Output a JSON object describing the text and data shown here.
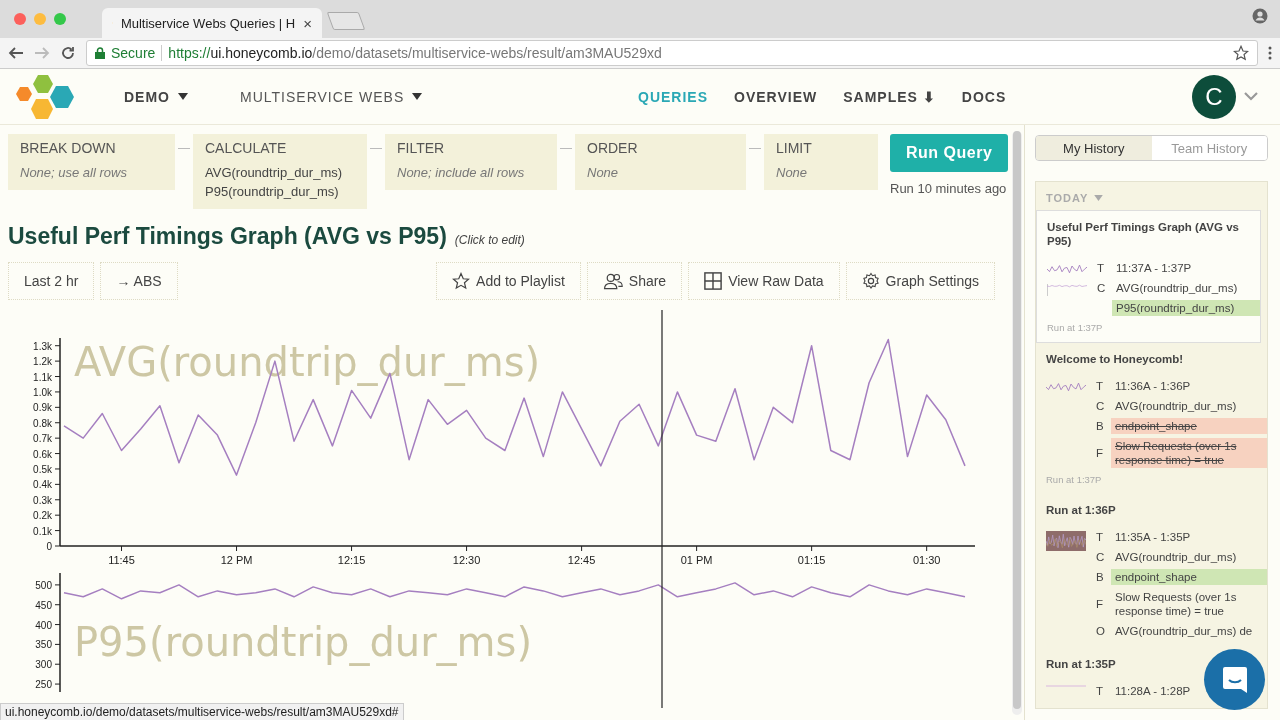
{
  "browser": {
    "tab_title": "Multiservice Webs Queries | H",
    "tab_close": "×",
    "secure_label": "Secure",
    "url_scheme": "https://",
    "url_host": "ui.honeycomb.io",
    "url_path": "/demo/datasets/multiservice-webs/result/am3MAU529xd"
  },
  "header": {
    "dataset_menus": [
      {
        "label": "DEMO"
      },
      {
        "label": "MULTISERVICE WEBS"
      }
    ],
    "nav": [
      {
        "label": "QUERIES",
        "selected": true
      },
      {
        "label": "OVERVIEW",
        "selected": false
      },
      {
        "label": "SAMPLES ⬇",
        "selected": false
      },
      {
        "label": "DOCS",
        "selected": false
      }
    ],
    "avatar": "C"
  },
  "query": {
    "clauses": [
      {
        "heading": "BREAK DOWN",
        "empty": true,
        "lines": [
          "None; use all rows"
        ]
      },
      {
        "heading": "CALCULATE",
        "empty": false,
        "lines": [
          "AVG(roundtrip_dur_ms)",
          "P95(roundtrip_dur_ms)"
        ]
      },
      {
        "heading": "FILTER",
        "empty": true,
        "lines": [
          "None; include all rows"
        ]
      },
      {
        "heading": "ORDER",
        "empty": true,
        "lines": [
          "None"
        ]
      },
      {
        "heading": "LIMIT",
        "empty": true,
        "lines": [
          "None"
        ]
      }
    ],
    "run_button": "Run Query",
    "run_status": "Run 10 minutes ago"
  },
  "title": "Useful Perf Timings Graph (AVG vs P95)",
  "edit_hint": "(Click to edit)",
  "toolbar": {
    "left": [
      {
        "label": "Last 2 hr"
      },
      {
        "label": "→ ABS"
      }
    ],
    "right": [
      {
        "label": "Add to Playlist",
        "kind": "star"
      },
      {
        "label": "Share",
        "kind": "people"
      },
      {
        "label": "View Raw Data",
        "kind": "grid"
      },
      {
        "label": "Graph Settings",
        "kind": "gear"
      }
    ]
  },
  "charts": [
    {
      "chart_data": {
        "type": "line",
        "categories": [
          null,
          null,
          null,
          "11:45",
          null,
          null,
          null,
          null,
          null,
          "12 PM",
          null,
          null,
          null,
          null,
          null,
          "12:15",
          null,
          null,
          null,
          null,
          null,
          "12:30",
          null,
          null,
          null,
          null,
          null,
          "12:45",
          null,
          null,
          null,
          null,
          null,
          "01 PM",
          null,
          null,
          null,
          null,
          null,
          "01:15",
          null,
          null,
          null,
          null,
          null,
          "01:30",
          null,
          null
        ],
        "ylim": [
          0,
          1350
        ],
        "series": [
          {
            "name": "AVG(roundtrip_dur_ms)",
            "color": "#a57fc0",
            "values": [
              780,
              700,
              860,
              620,
              760,
              910,
              540,
              850,
              720,
              460,
              800,
              1200,
              680,
              950,
              650,
              1010,
              830,
              1120,
              560,
              950,
              790,
              880,
              700,
              620,
              960,
              580,
              1000,
              760,
              520,
              810,
              920,
              650,
              1000,
              720,
              680,
              1020,
              560,
              900,
              800,
              1300,
              620,
              560,
              1060,
              1340,
              580,
              980,
              820,
              520
            ]
          }
        ],
        "yticks": [
          {
            "value": 0,
            "label": "0"
          },
          {
            "value": 100,
            "label": "0.1k"
          },
          {
            "value": 200,
            "label": "0.2k"
          },
          {
            "value": 300,
            "label": "0.3k"
          },
          {
            "value": 400,
            "label": "0.4k"
          },
          {
            "value": 500,
            "label": "0.5k"
          },
          {
            "value": 600,
            "label": "0.6k"
          },
          {
            "value": 700,
            "label": "0.7k"
          },
          {
            "value": 800,
            "label": "0.8k"
          },
          {
            "value": 900,
            "label": "0.9k"
          },
          {
            "value": 1000,
            "label": "1.0k"
          },
          {
            "value": 1100,
            "label": "1.1k"
          },
          {
            "value": 1200,
            "label": "1.2k"
          },
          {
            "value": 1300,
            "label": "1.3k"
          }
        ]
      }
    },
    {
      "chart_data": {
        "type": "line",
        "ylim": [
          230,
          530
        ],
        "series": [
          {
            "name": "P95(roundtrip_dur_ms)",
            "color": "#a57fc0",
            "values": [
              480,
              470,
              490,
              465,
              485,
              480,
              500,
              470,
              485,
              475,
              480,
              490,
              470,
              495,
              480,
              475,
              490,
              470,
              485,
              480,
              475,
              490,
              480,
              470,
              495,
              485,
              470,
              480,
              490,
              475,
              485,
              500,
              470,
              480,
              490,
              505,
              475,
              485,
              470,
              495,
              480,
              470,
              500,
              485,
              475,
              490,
              480,
              470
            ]
          }
        ],
        "yticks": [
          250,
          300,
          350,
          400,
          450,
          500
        ]
      }
    }
  ],
  "status_url": "ui.honeycomb.io/demo/datasets/multiservice-webs/result/am3MAU529xd#",
  "history": {
    "tabs": [
      {
        "label": "My History",
        "selected": true
      },
      {
        "label": "Team History",
        "selected": false
      }
    ],
    "group": "TODAY",
    "entries": [
      {
        "title": "Useful Perf Timings Graph (AVG vs P95)",
        "selected": true,
        "run_at": "Run at 1:37P",
        "rows": [
          {
            "letter": "T",
            "text": "11:37A - 1:37P",
            "added": false,
            "removed": false
          },
          {
            "letter": "C",
            "text": "AVG(roundtrip_dur_ms)",
            "added": false,
            "removed": false
          },
          {
            "text": "P95(roundtrip_dur_ms)",
            "added": true,
            "removed": false
          }
        ]
      },
      {
        "title": "Welcome to Honeycomb!",
        "selected": false,
        "run_at": "Run at 1:37P",
        "rows": [
          {
            "letter": "T",
            "text": "11:36A - 1:36P",
            "added": false,
            "removed": false
          },
          {
            "letter": "C",
            "text": "AVG(roundtrip_dur_ms)",
            "added": false,
            "removed": false
          },
          {
            "letter": "B",
            "text": "endpoint_shape",
            "added": false,
            "removed": true
          },
          {
            "letter": "F",
            "text": "Slow Requests (over 1s response time) = true",
            "added": false,
            "removed": true
          }
        ]
      },
      {
        "title": "Run at 1:36P",
        "selected": false,
        "rows": [
          {
            "letter": "T",
            "text": "11:35A - 1:35P",
            "added": false,
            "removed": false
          },
          {
            "letter": "C",
            "text": "AVG(roundtrip_dur_ms)",
            "added": false,
            "removed": false
          },
          {
            "letter": "B",
            "text": "endpoint_shape",
            "added": true,
            "removed": false
          },
          {
            "letter": "F",
            "text": "Slow Requests (over 1s response time) = true",
            "added": false,
            "removed": false
          },
          {
            "letter": "O",
            "text": "AVG(roundtrip_dur_ms) de",
            "added": false,
            "removed": false
          }
        ]
      },
      {
        "title": "Run at 1:35P",
        "selected": false,
        "rows": [
          {
            "letter": "T",
            "text": "11:28A - 1:28P",
            "added": false,
            "removed": false
          }
        ]
      }
    ]
  }
}
